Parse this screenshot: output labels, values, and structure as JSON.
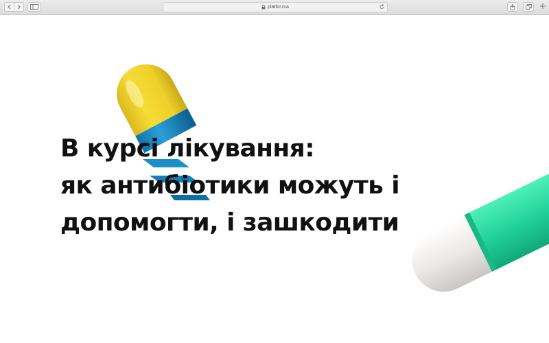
{
  "browser": {
    "url": "platfor.ma",
    "icons": {
      "back": "chevron-left-icon",
      "forward": "chevron-right-icon",
      "sidebar": "sidebar-icon",
      "share": "share-icon",
      "tabs": "tabs-icon",
      "new_tab": "plus-icon",
      "reload": "reload-icon"
    }
  },
  "hero": {
    "title_lines": [
      "В курсі лікування:",
      "як антибіотики можуть і",
      "допомогти, і зашкодити"
    ],
    "colors": {
      "text": "#111111",
      "pill_yellow": "#f2d22c",
      "pill_blue": "#1a8fc8",
      "pill_green": "#22d39a",
      "pill_white": "#e9e7e6"
    }
  }
}
